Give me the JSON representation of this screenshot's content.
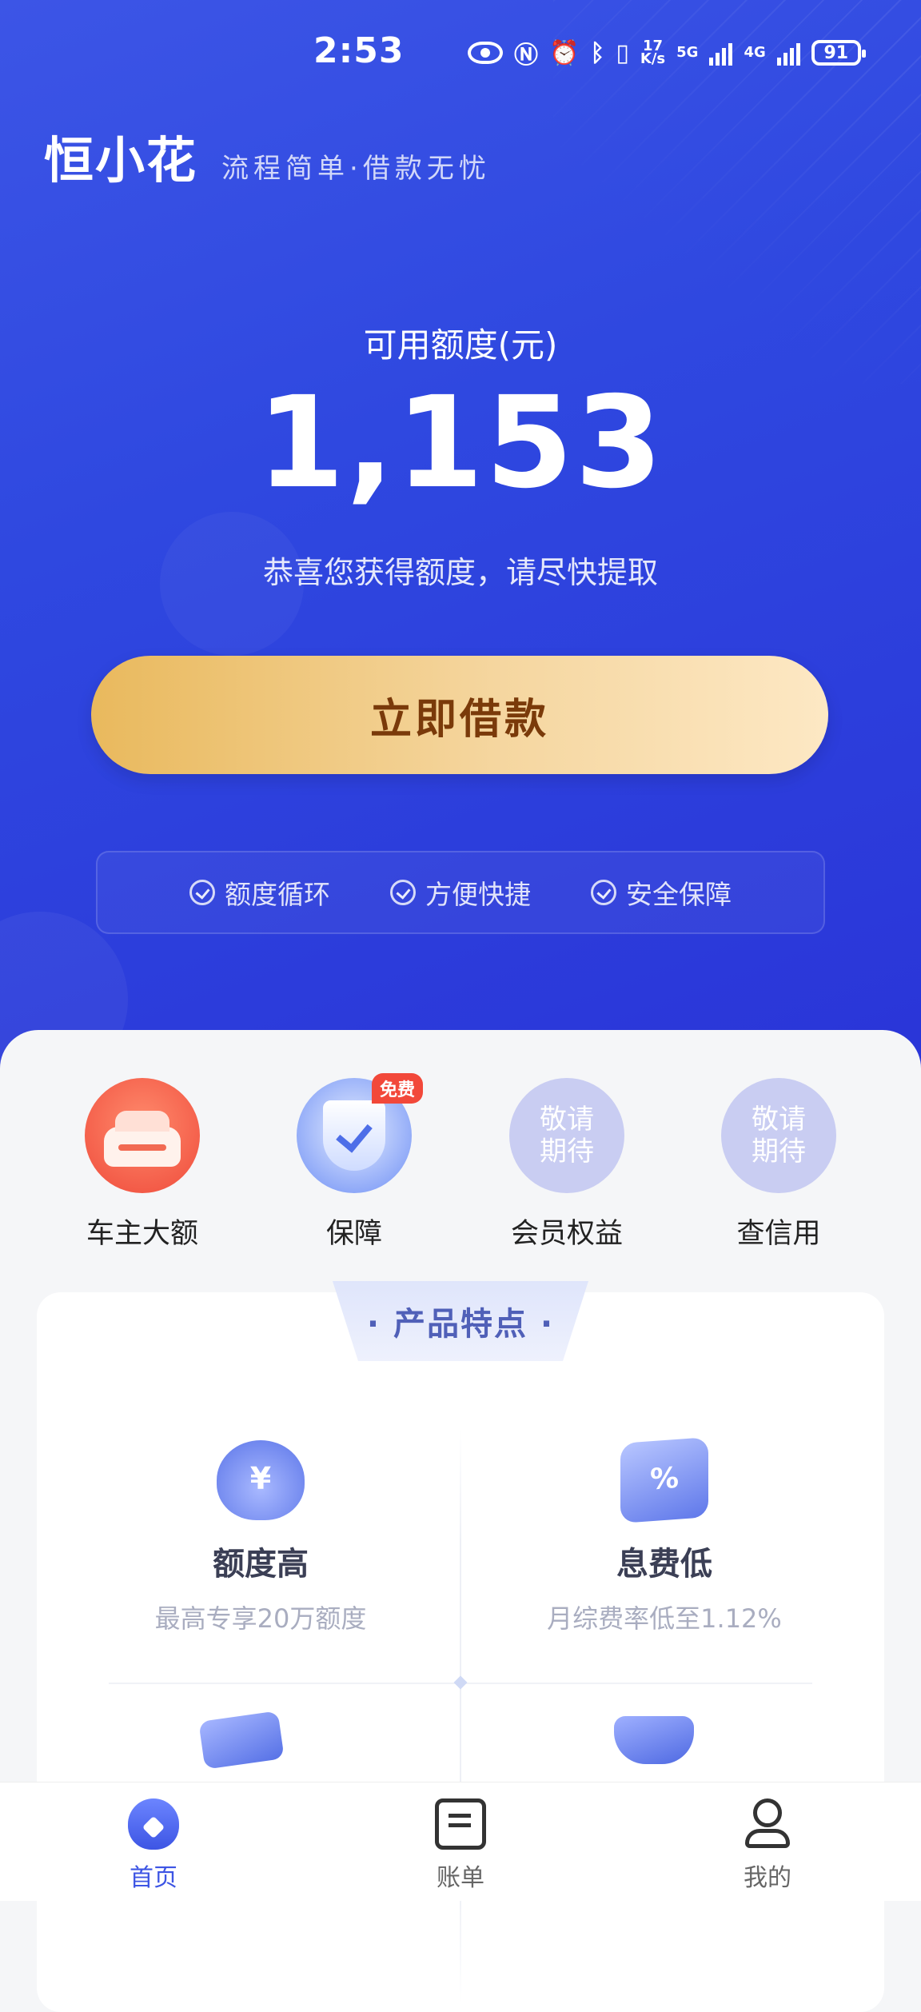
{
  "status_bar": {
    "time": "2:53",
    "net_speed_value": "17",
    "net_speed_unit": "K/s",
    "net1": "5G",
    "net2": "4G",
    "battery": "91"
  },
  "brand": {
    "logo": "恒小花",
    "slogan": "流程简单·借款无忧"
  },
  "quota": {
    "label": "可用额度(元)",
    "value": "1,153",
    "tip": "恭喜您获得额度，请尽快提取"
  },
  "borrow_button": {
    "label": "立即借款"
  },
  "features": [
    {
      "label": "额度循环"
    },
    {
      "label": "方便快捷"
    },
    {
      "label": "安全保障"
    }
  ],
  "quick_entries": [
    {
      "label": "车主大额"
    },
    {
      "label": "保障",
      "tag": "免费"
    },
    {
      "label": "会员权益",
      "placeholder_line1": "敬请",
      "placeholder_line2": "期待"
    },
    {
      "label": "查信用",
      "placeholder_line1": "敬请",
      "placeholder_line2": "期待"
    }
  ],
  "product_features": {
    "title": "· 产品特点 ·",
    "items": [
      {
        "title": "额度高",
        "subtitle": "最高专享20万额度"
      },
      {
        "title": "息费低",
        "subtitle": "月综费率低至1.12%"
      }
    ]
  },
  "tabbar": [
    {
      "label": "首页",
      "active": true
    },
    {
      "label": "账单",
      "active": false
    },
    {
      "label": "我的",
      "active": false
    }
  ],
  "colors": {
    "hero_blue": "#2f48e0",
    "button_gold": "#e9b95d",
    "button_text": "#7a3a0a",
    "accent": "#3d55e4",
    "badge_red": "#f2483a"
  }
}
